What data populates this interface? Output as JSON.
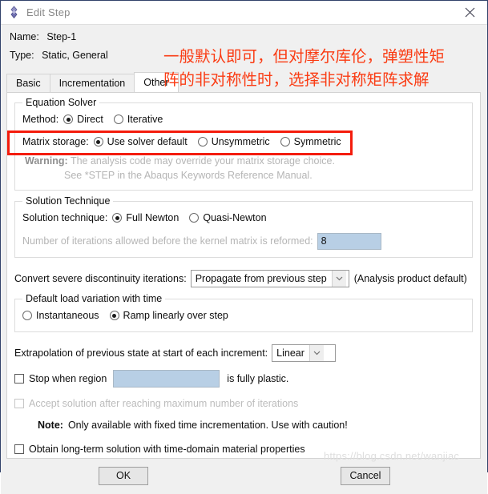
{
  "window": {
    "title": "Edit Step",
    "icon": "abaqus-diamond-icon",
    "close_icon": "close-icon"
  },
  "header": {
    "name_label": "Name:",
    "name_value": "Step-1",
    "type_label": "Type:",
    "type_value": "Static, General"
  },
  "annotation": {
    "text": "一般默认即可，但对摩尔库伦，弹塑性矩\n阵的非对称性时，选择非对称矩阵求解",
    "color": "#fa3c14"
  },
  "tabs": [
    {
      "label": "Basic",
      "active": false
    },
    {
      "label": "Incrementation",
      "active": false
    },
    {
      "label": "Other",
      "active": true
    }
  ],
  "equation_solver": {
    "legend": "Equation Solver",
    "method_label": "Method:",
    "method_options": [
      {
        "label": "Direct",
        "checked": true
      },
      {
        "label": "Iterative",
        "checked": false
      }
    ],
    "matrix_storage_label": "Matrix storage:",
    "matrix_storage_options": [
      {
        "label": "Use solver default",
        "checked": true
      },
      {
        "label": "Unsymmetric",
        "checked": false
      },
      {
        "label": "Symmetric",
        "checked": false
      }
    ],
    "warning_label": "Warning:",
    "warning_line1": "The analysis code may override your matrix storage choice.",
    "warning_line2": "See *STEP in the Abaqus Keywords Reference Manual."
  },
  "solution_technique": {
    "legend": "Solution Technique",
    "technique_label": "Solution technique:",
    "technique_options": [
      {
        "label": "Full Newton",
        "checked": true
      },
      {
        "label": "Quasi-Newton",
        "checked": false
      }
    ],
    "iterations_label": "Number of iterations allowed before the kernel matrix is reformed:",
    "iterations_value": "8"
  },
  "discontinuity": {
    "label": "Convert severe discontinuity iterations:",
    "value": "Propagate from previous step",
    "suffix": "(Analysis product default)"
  },
  "load_variation": {
    "legend": "Default load variation with time",
    "options": [
      {
        "label": "Instantaneous",
        "checked": false
      },
      {
        "label": "Ramp linearly over step",
        "checked": true
      }
    ]
  },
  "extrapolation": {
    "label": "Extrapolation of previous state at start of each increment:",
    "value": "Linear"
  },
  "stop_region": {
    "label": "Stop when region",
    "field_value": "",
    "suffix": "is fully plastic.",
    "checked": false
  },
  "accept_solution": {
    "label": "Accept solution after reaching maximum number of iterations",
    "checked": false,
    "disabled": true
  },
  "note": {
    "label": "Note:",
    "text": "Only available with fixed time incrementation. Use with caution!"
  },
  "long_term": {
    "label": "Obtain long-term solution with time-domain material properties",
    "checked": false
  },
  "buttons": {
    "ok": "OK",
    "cancel": "Cancel"
  },
  "watermark": {
    "text": "https://blog.csdn.net/wanjiac"
  }
}
